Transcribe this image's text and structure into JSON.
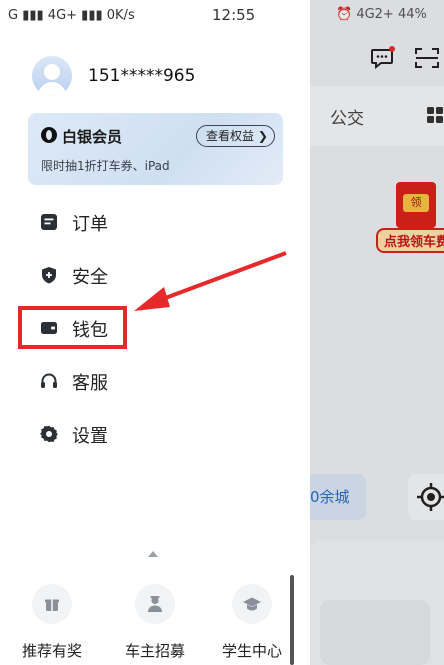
{
  "status_bar": {
    "left": "G ▮▮▮ 4G+ ▮▮▮ 0K/s",
    "time": "12:55"
  },
  "background_app": {
    "status": "⏰ 4G2+ 44%",
    "tab_label": "公交",
    "red_packet_coin": "领",
    "red_packet_label": "点我领车费",
    "city_chip": "0余城"
  },
  "profile": {
    "phone": "151*****965"
  },
  "vip": {
    "title": "白银会员",
    "subtitle": "限时抽1折打车券、iPad",
    "button": "查看权益 ❯"
  },
  "menu": {
    "items": [
      {
        "label": "订单",
        "icon": "order-icon"
      },
      {
        "label": "安全",
        "icon": "shield-icon"
      },
      {
        "label": "钱包",
        "icon": "wallet-icon"
      },
      {
        "label": "客服",
        "icon": "headset-icon"
      },
      {
        "label": "设置",
        "icon": "gear-icon"
      }
    ]
  },
  "bottom": {
    "items": [
      {
        "label": "推荐有奖",
        "icon": "gift-icon"
      },
      {
        "label": "车主招募",
        "icon": "driver-icon"
      },
      {
        "label": "学生中心",
        "icon": "graduation-cap-icon"
      }
    ]
  },
  "colors": {
    "highlight": "#e8292b",
    "menu_icon": "#2b2f36",
    "vip_card": "#d6e4f5"
  }
}
